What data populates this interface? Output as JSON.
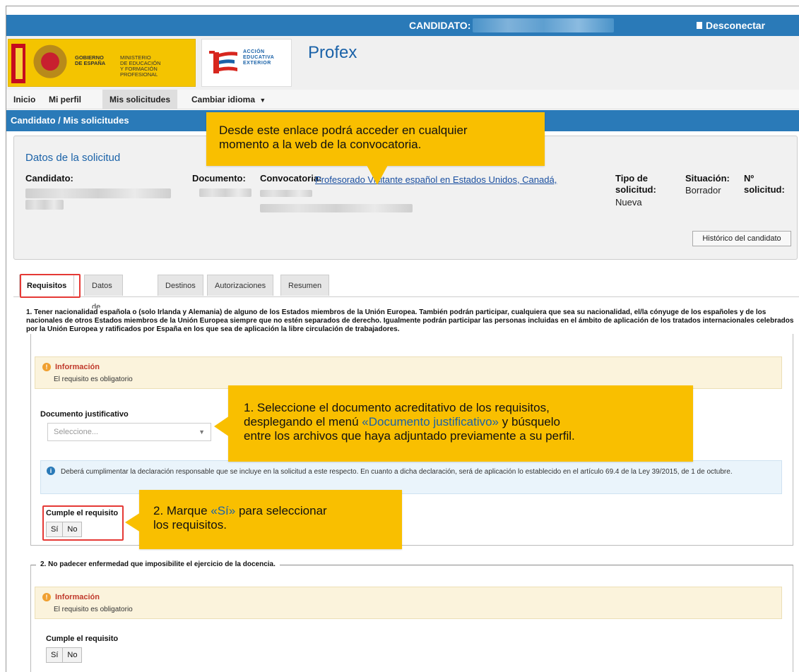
{
  "topbar": {
    "candidate_label": "CANDIDATO:",
    "logout_label": "Desconectar"
  },
  "header": {
    "gov_text": [
      "GOBIERNO",
      "DE ESPAÑA"
    ],
    "ministry_text": [
      "MINISTERIO",
      "DE EDUCACIÓN",
      "Y FORMACIÓN PROFESIONAL"
    ],
    "aee_text": [
      "ACCIÓN",
      "EDUCATIVA",
      "EXTERIOR"
    ],
    "app_title": "Profex"
  },
  "nav": {
    "items": [
      "Inicio",
      "Mi perfil",
      "Mis solicitudes",
      "Cambiar idioma"
    ],
    "dropdown_glyph": "▼"
  },
  "breadcrumb": "Candidato / Mis solicitudes",
  "solicitud": {
    "title": "Datos de la solicitud",
    "candidato_label": "Candidato:",
    "documento_label": "Documento:",
    "convocatoria_label": "Convocatoria:",
    "convocatoria_link": "Profesorado Visitante español en Estados Unidos, Canadá,",
    "tipo_label": [
      "Tipo de",
      "solicitud:"
    ],
    "tipo_value": "Nueva",
    "situacion_label": "Situación:",
    "situacion_value": "Borrador",
    "numero_label": [
      "Nº",
      "solicitud:"
    ],
    "historico_button": "Histórico del candidato"
  },
  "tabs": [
    "Requisitos",
    "Datos de interés",
    "Destinos",
    "Autorizaciones",
    "Resumen"
  ],
  "requisito1": {
    "legend": "1. Tener nacionalidad española o (solo Irlanda y Alemania) de alguno de los Estados miembros de la Unión Europea. También podrán participar, cualquiera que sea su nacionalidad, el/la cónyuge de los españoles y de los nacionales de otros Estados miembros de la Unión Europea siempre que no estén separados de derecho. Igualmente podrán participar las personas incluidas en el ámbito de aplicación de los tratados internacionales celebrados por la Unión Europea y ratificados por España en los que sea de aplicación la libre circulación de trabajadores.",
    "info_title": "Información",
    "info_text": "El requisito es obligatorio",
    "doc_label": "Documento justificativo",
    "doc_placeholder": "Seleccione...",
    "note": "Deberá cumplimentar la declaración responsable que se incluye en la solicitud a este respecto. En cuanto a dicha declaración, será de aplicación lo establecido en el artículo 69.4 de la Ley 39/2015, de 1 de octubre.",
    "cumple_label": "Cumple el requisito",
    "yes": "Sí",
    "no": "No"
  },
  "requisito2": {
    "legend": "2. No padecer enfermedad que imposibilite el ejercicio de la docencia.",
    "info_title": "Información",
    "info_text": "El requisito es obligatorio",
    "cumple_label": "Cumple el requisito",
    "yes": "Sí",
    "no": "No"
  },
  "callouts": {
    "link_tip": [
      "Desde este enlace podrá acceder en cualquier",
      "momento a la web de la convocatoria."
    ],
    "doc_tip": {
      "line1": "1. Seleccione el documento acreditativo de los requisitos,",
      "line2_pre": "desplegando el menú ",
      "line2_highlight": "«Documento justificativo»",
      "line2_post": " y búsquelo",
      "line3": "entre los archivos que haya adjuntado previamente a su perfil."
    },
    "yes_tip": {
      "line1_pre": "2. Marque ",
      "line1_highlight": "«Sí»",
      "line1_post": " para seleccionar",
      "line2": "los requisitos."
    }
  },
  "colors": {
    "primary_blue": "#2a7ab8",
    "callout_yellow": "#f9bf00",
    "highlight_red": "#e53935",
    "link_blue": "#1a4fa0"
  }
}
